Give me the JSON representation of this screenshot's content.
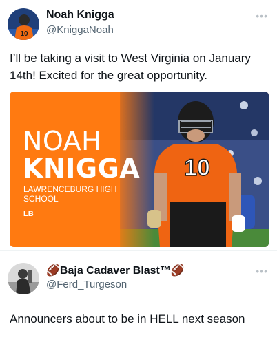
{
  "tweet1": {
    "display_name": "Noah Knigga",
    "handle": "@KniggaNoah",
    "more_label": "•••",
    "text": "I’ll be taking a visit to West Virginia on January 14th! Excited for the great opportunity.",
    "graphic": {
      "name_line1": "NOAH",
      "name_line2": "KNIGGA",
      "school": "LAWRENCEBURG HIGH SCHOOL",
      "position": "LB",
      "jersey_number": "10"
    }
  },
  "tweet2": {
    "display_name_prefix": "🏈Baja Cadaver Blast™",
    "display_name_suffix": "🏈",
    "handle": "@Ferd_Turgeson",
    "more_label": "•••",
    "text": "Announcers about to be in HELL next season"
  },
  "colors": {
    "graphic_orange": "#ff7a11",
    "handle_gray": "#536471",
    "text_dark": "#0f1419"
  }
}
